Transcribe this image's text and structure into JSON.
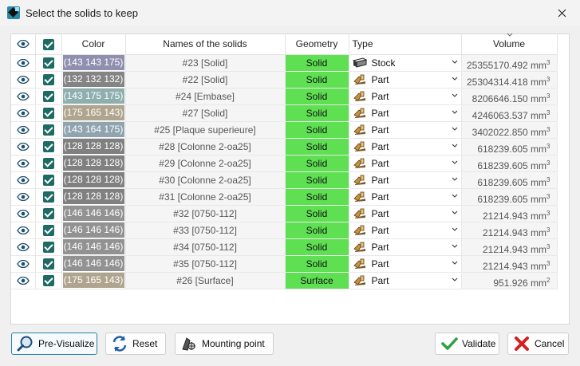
{
  "window": {
    "title": "Select the solids to keep"
  },
  "table": {
    "headers": {
      "color": "Color",
      "name": "Names of the solids",
      "geometry": "Geometry",
      "type": "Type",
      "volume": "Volume"
    },
    "rows": [
      {
        "color_label": "(143 143 175)",
        "color_hex": "#8f8faf",
        "name": "#23 [Solid]",
        "geometry": "Solid",
        "type": "Stock",
        "type_icon": "stock-icon",
        "volume": "25355170.492 mm",
        "unit_exp": "3"
      },
      {
        "color_label": "(132 132 132)",
        "color_hex": "#848484",
        "name": "#22 [Solid]",
        "geometry": "Solid",
        "type": "Part",
        "type_icon": "part-icon",
        "volume": "25304314.418 mm",
        "unit_exp": "3"
      },
      {
        "color_label": "(143 175 175)",
        "color_hex": "#8fafaf",
        "name": "#24 [Embase]",
        "geometry": "Solid",
        "type": "Part",
        "type_icon": "part-icon",
        "volume": "8206646.150 mm",
        "unit_exp": "3"
      },
      {
        "color_label": "(175 165 143)",
        "color_hex": "#afa58f",
        "name": "#27 [Solid]",
        "geometry": "Solid",
        "type": "Part",
        "type_icon": "part-icon",
        "volume": "4246063.537 mm",
        "unit_exp": "3"
      },
      {
        "color_label": "(143 164 175)",
        "color_hex": "#8fa4af",
        "name": "#25 [Plaque superieure]",
        "geometry": "Solid",
        "type": "Part",
        "type_icon": "part-icon",
        "volume": "3402022.850 mm",
        "unit_exp": "3"
      },
      {
        "color_label": "(128 128 128)",
        "color_hex": "#808080",
        "name": "#28 [Colonne 2-oa25]",
        "geometry": "Solid",
        "type": "Part",
        "type_icon": "part-icon",
        "volume": "618239.605 mm",
        "unit_exp": "3"
      },
      {
        "color_label": "(128 128 128)",
        "color_hex": "#808080",
        "name": "#29 [Colonne 2-oa25]",
        "geometry": "Solid",
        "type": "Part",
        "type_icon": "part-icon",
        "volume": "618239.605 mm",
        "unit_exp": "3"
      },
      {
        "color_label": "(128 128 128)",
        "color_hex": "#808080",
        "name": "#30 [Colonne 2-oa25]",
        "geometry": "Solid",
        "type": "Part",
        "type_icon": "part-icon",
        "volume": "618239.605 mm",
        "unit_exp": "3"
      },
      {
        "color_label": "(128 128 128)",
        "color_hex": "#808080",
        "name": "#31 [Colonne 2-oa25]",
        "geometry": "Solid",
        "type": "Part",
        "type_icon": "part-icon",
        "volume": "618239.605 mm",
        "unit_exp": "3"
      },
      {
        "color_label": "(146 146 146)",
        "color_hex": "#929292",
        "name": "#32 [0750-112]",
        "geometry": "Solid",
        "type": "Part",
        "type_icon": "part-icon",
        "volume": "21214.943 mm",
        "unit_exp": "3"
      },
      {
        "color_label": "(146 146 146)",
        "color_hex": "#929292",
        "name": "#33 [0750-112]",
        "geometry": "Solid",
        "type": "Part",
        "type_icon": "part-icon",
        "volume": "21214.943 mm",
        "unit_exp": "3"
      },
      {
        "color_label": "(146 146 146)",
        "color_hex": "#929292",
        "name": "#34 [0750-112]",
        "geometry": "Solid",
        "type": "Part",
        "type_icon": "part-icon",
        "volume": "21214.943 mm",
        "unit_exp": "3"
      },
      {
        "color_label": "(146 146 146)",
        "color_hex": "#929292",
        "name": "#35 [0750-112]",
        "geometry": "Solid",
        "type": "Part",
        "type_icon": "part-icon",
        "volume": "21214.943 mm",
        "unit_exp": "3"
      },
      {
        "color_label": "(175 165 143)",
        "color_hex": "#afa58f",
        "name": "#26 [Surface]",
        "geometry": "Surface",
        "type": "Part",
        "type_icon": "part-icon",
        "volume": "951.926 mm",
        "unit_exp": "2"
      }
    ]
  },
  "buttons": {
    "previsualize": "Pre-Visualize",
    "reset": "Reset",
    "mounting_point": "Mounting point",
    "validate": "Validate",
    "cancel": "Cancel"
  },
  "colors": {
    "geometry_green": "#5ee052",
    "checkbox_teal": "#1e6b63",
    "validate_green": "#2ea043",
    "cancel_red": "#d42020",
    "accent_blue": "#2c7fa6"
  }
}
